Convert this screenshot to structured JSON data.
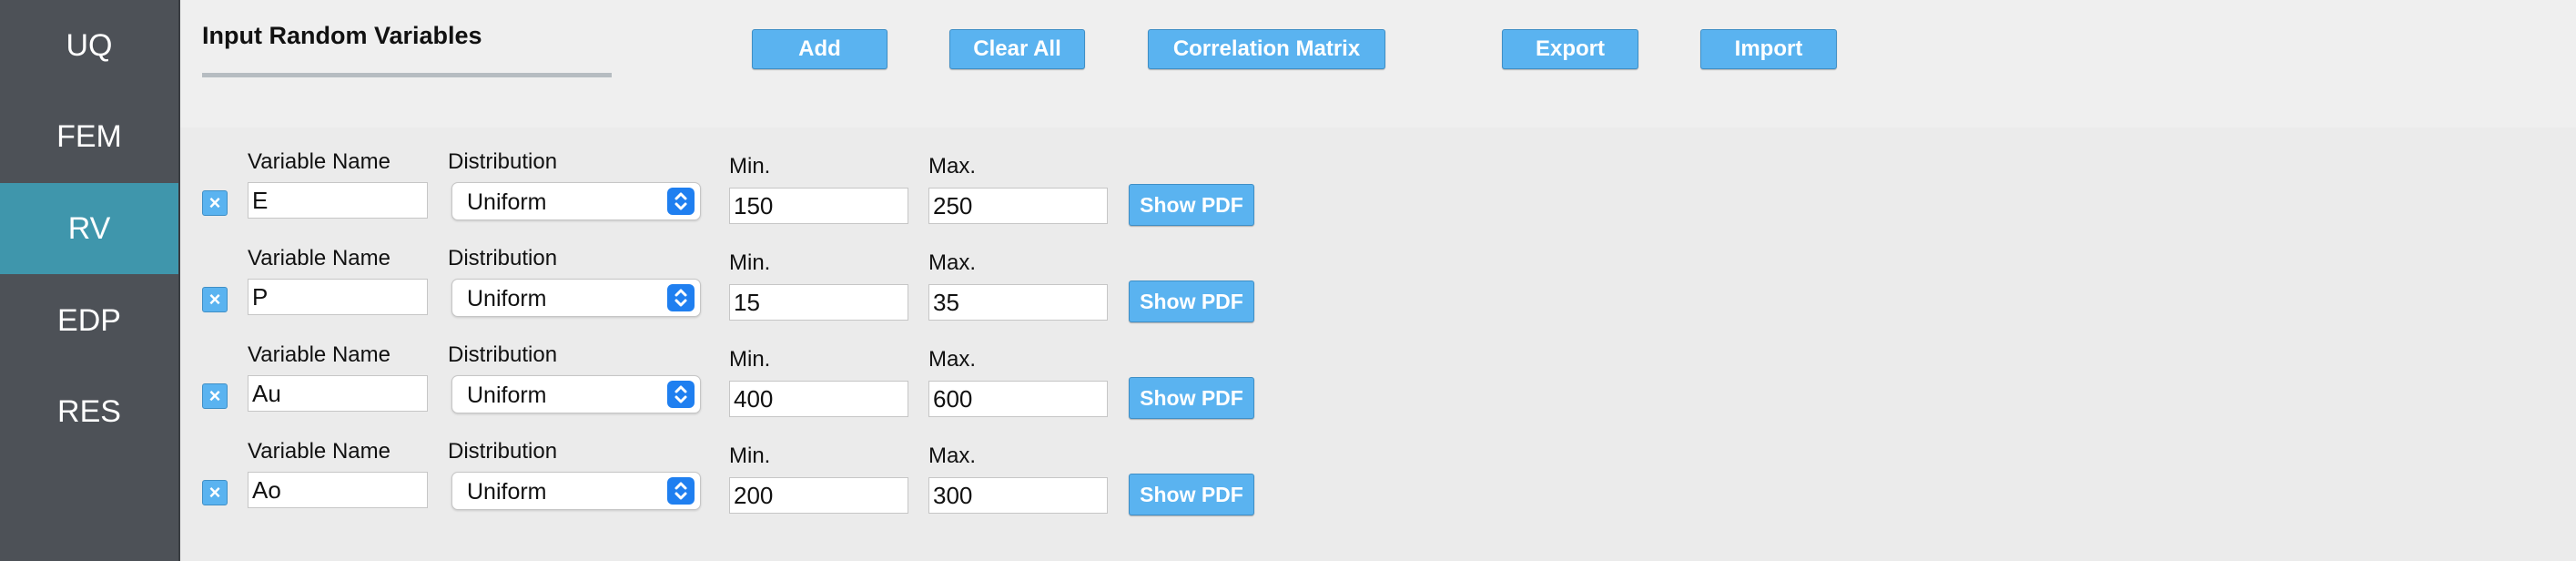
{
  "sidebar": {
    "items": [
      {
        "label": "UQ",
        "active": false
      },
      {
        "label": "FEM",
        "active": false
      },
      {
        "label": "RV",
        "active": true
      },
      {
        "label": "EDP",
        "active": false
      },
      {
        "label": "RES",
        "active": false
      }
    ]
  },
  "header": {
    "title": "Input Random Variables",
    "buttons": {
      "add": "Add",
      "clear_all": "Clear All",
      "correlation_matrix": "Correlation Matrix",
      "export": "Export",
      "import": "Import"
    }
  },
  "labels": {
    "variable_name": "Variable Name",
    "distribution": "Distribution",
    "min": "Min.",
    "max": "Max.",
    "show_pdf": "Show PDF",
    "delete": "×"
  },
  "variables": [
    {
      "name": "E",
      "distribution": "Uniform",
      "min": "150",
      "max": "250"
    },
    {
      "name": "P",
      "distribution": "Uniform",
      "min": "15",
      "max": "35"
    },
    {
      "name": "Au",
      "distribution": "Uniform",
      "min": "400",
      "max": "600"
    },
    {
      "name": "Ao",
      "distribution": "Uniform",
      "min": "200",
      "max": "300"
    }
  ],
  "colors": {
    "sidebar_bg": "#4d5157",
    "sidebar_active": "#3f96ac",
    "button_bg": "#5ab3f0",
    "select_arrow": "#1f7ff0"
  },
  "icons": {
    "delete": "close-icon",
    "select": "up-down-chevron-icon"
  }
}
